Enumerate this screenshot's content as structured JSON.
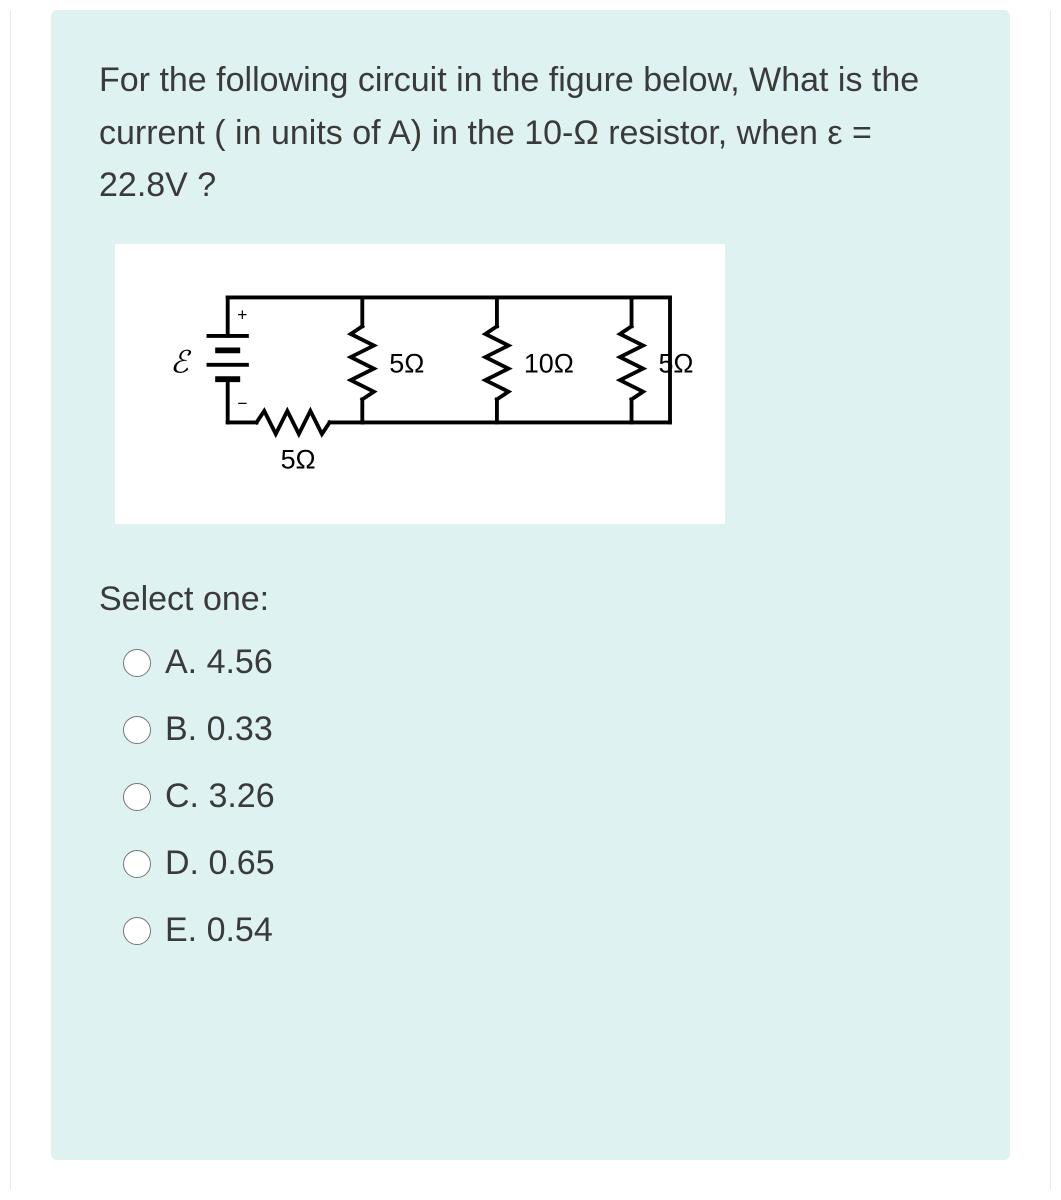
{
  "question_text": "For the following circuit in the figure below, What is the current ( in units of A)  in the 10-Ω resistor, when ε = 22.8V ?",
  "circuit": {
    "source_label": "ℰ",
    "resistors": {
      "r1_series": "5Ω",
      "r2_parallel": "5Ω",
      "r3_parallel": "10Ω",
      "r4_parallel": "5Ω"
    }
  },
  "select_label": "Select one:",
  "options": [
    {
      "id": "optA",
      "label": "A. 4.56"
    },
    {
      "id": "optB",
      "label": "B. 0.33"
    },
    {
      "id": "optC",
      "label": "C. 3.26"
    },
    {
      "id": "optD",
      "label": "D. 0.65"
    },
    {
      "id": "optE",
      "label": "E. 0.54"
    }
  ]
}
